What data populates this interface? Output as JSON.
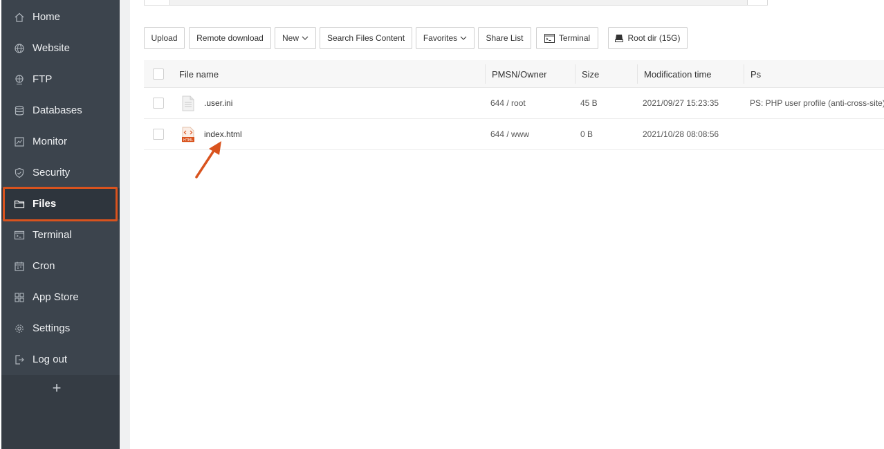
{
  "sidebar": {
    "items": [
      {
        "label": "Home",
        "icon": "home-icon"
      },
      {
        "label": "Website",
        "icon": "globe-icon"
      },
      {
        "label": "FTP",
        "icon": "ftp-globe-icon"
      },
      {
        "label": "Databases",
        "icon": "database-icon"
      },
      {
        "label": "Monitor",
        "icon": "monitor-icon"
      },
      {
        "label": "Security",
        "icon": "shield-icon"
      },
      {
        "label": "Files",
        "icon": "folder-icon",
        "active": true
      },
      {
        "label": "Terminal",
        "icon": "terminal-icon"
      },
      {
        "label": "Cron",
        "icon": "calendar-icon"
      },
      {
        "label": "App Store",
        "icon": "grid-icon"
      },
      {
        "label": "Settings",
        "icon": "gear-icon"
      },
      {
        "label": "Log out",
        "icon": "logout-icon"
      }
    ],
    "add_label": "+"
  },
  "toolbar": {
    "upload": "Upload",
    "remote_download": "Remote download",
    "new": "New",
    "search_files_content": "Search Files Content",
    "favorites": "Favorites",
    "share_list": "Share List",
    "terminal": "Terminal",
    "root_dir": "Root dir (15G)"
  },
  "table": {
    "headers": {
      "name": "File name",
      "perm": "PMSN/Owner",
      "size": "Size",
      "mtime": "Modification time",
      "ps": "Ps"
    },
    "rows": [
      {
        "name": ".user.ini",
        "perm": "644 / root",
        "size": "45 B",
        "mtime": "2021/09/27 15:23:35",
        "ps": "PS: PHP user profile (anti-cross-site)",
        "icon": "text-file-icon"
      },
      {
        "name": "index.html",
        "perm": "644 / www",
        "size": "0 B",
        "mtime": "2021/10/28 08:08:56",
        "ps": "",
        "icon": "html-file-icon"
      }
    ]
  },
  "colors": {
    "sidebar_bg": "#3c444d",
    "sidebar_active_bg": "#2e353d",
    "highlight": "#d9531e"
  }
}
